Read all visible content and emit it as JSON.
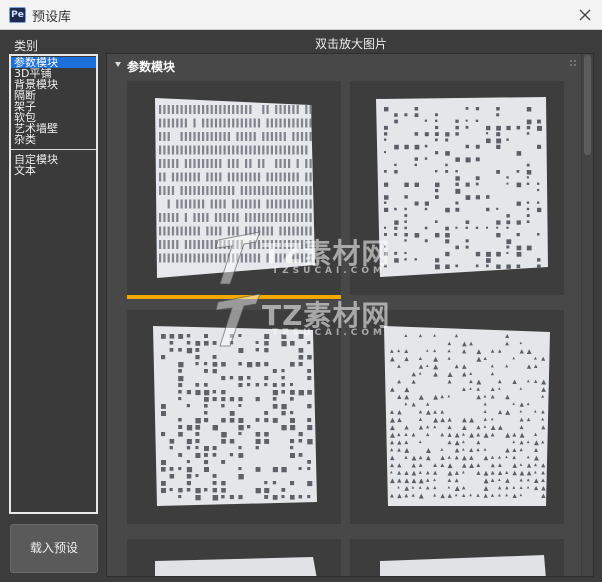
{
  "window": {
    "app_icon_text": "Pe",
    "title": "预设库"
  },
  "sidebar": {
    "label": "类别",
    "items": [
      {
        "label": "参数模块",
        "selected": true
      },
      {
        "label": "3D平铺",
        "selected": false
      },
      {
        "label": "背景模块",
        "selected": false
      },
      {
        "label": "隔断",
        "selected": false
      },
      {
        "label": "架子",
        "selected": false
      },
      {
        "label": "软包",
        "selected": false
      },
      {
        "label": "艺术墙壁",
        "selected": false
      },
      {
        "label": "杂类",
        "selected": false
      }
    ],
    "custom_items": [
      {
        "label": "自定模块"
      },
      {
        "label": "文本"
      }
    ],
    "load_button": "载入预设"
  },
  "main": {
    "hint": "双击放大图片",
    "group_title": "参数模块"
  },
  "watermark": {
    "brand": "TZ素材网",
    "domain": "TZSUCAI.COM"
  },
  "colors": {
    "selection": "#1e6fd9",
    "active_underline": "#f2a900",
    "panel_bg": "#484848"
  }
}
